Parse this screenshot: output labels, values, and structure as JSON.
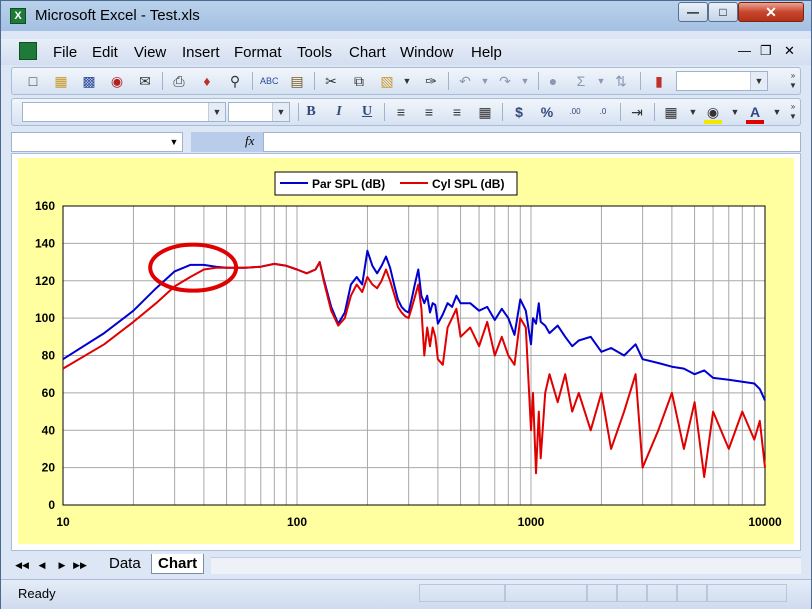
{
  "window": {
    "title": "Microsoft Excel - Test.xls",
    "app_icon": "excel-app-icon",
    "controls": {
      "minimize": "minimize-icon",
      "maximize": "maximize-icon",
      "close": "close-icon"
    }
  },
  "menubar": {
    "items": [
      {
        "label": "File"
      },
      {
        "label": "Edit"
      },
      {
        "label": "View"
      },
      {
        "label": "Insert"
      },
      {
        "label": "Format"
      },
      {
        "label": "Tools"
      },
      {
        "label": "Chart"
      },
      {
        "label": "Window"
      },
      {
        "label": "Help"
      }
    ]
  },
  "toolbar_standard": {
    "icons": [
      "new-icon",
      "open-icon",
      "save-icon",
      "permission-icon",
      "email-icon",
      "print-icon",
      "research-icon",
      "print-preview-icon",
      "spelling-icon",
      "research-book-icon",
      "cut-icon",
      "copy-icon",
      "paste-icon",
      "format-painter-icon",
      "undo-icon",
      "redo-icon",
      "hyperlink-icon",
      "autosum-icon",
      "sort-icon",
      "chart-wizard-icon"
    ],
    "zoom_value": ""
  },
  "toolbar_formatting": {
    "font_name": "",
    "font_size": "",
    "bold": "B",
    "italic": "I",
    "underline": "U",
    "icons": [
      "align-left-icon",
      "center-icon",
      "align-right-icon",
      "merge-center-icon",
      "currency-icon",
      "percent-icon",
      "increase-decimal-icon",
      "decrease-decimal-icon",
      "indent-icon",
      "borders-icon",
      "fill-color-icon",
      "font-color-icon"
    ],
    "fill_color": "#f5e600",
    "font_color": "#e00000"
  },
  "formula_bar": {
    "name_box": "",
    "fx_label": "fx",
    "content": ""
  },
  "chart_data": {
    "type": "line",
    "title": "",
    "xlabel": "",
    "ylabel": "",
    "xscale": "log",
    "xlim": [
      10,
      10000
    ],
    "ylim": [
      0,
      160
    ],
    "xticks": [
      "10",
      "100",
      "1000",
      "10000"
    ],
    "yticks": [
      "0",
      "20",
      "40",
      "60",
      "80",
      "100",
      "120",
      "140",
      "160"
    ],
    "grid": true,
    "legend": "top-center",
    "background": "#ffffa0",
    "series": [
      {
        "name": "Par SPL (dB)",
        "color": "#0000d0",
        "x": [
          10,
          15,
          20,
          25,
          30,
          35,
          40,
          45,
          50,
          60,
          70,
          80,
          90,
          100,
          110,
          120,
          125,
          130,
          140,
          150,
          160,
          170,
          180,
          190,
          200,
          210,
          220,
          230,
          240,
          250,
          260,
          270,
          280,
          290,
          300,
          310,
          320,
          330,
          340,
          350,
          360,
          370,
          380,
          390,
          400,
          420,
          440,
          460,
          480,
          500,
          550,
          600,
          650,
          700,
          750,
          800,
          850,
          900,
          950,
          1000,
          1020,
          1050,
          1080,
          1100,
          1150,
          1200,
          1300,
          1400,
          1500,
          1600,
          1800,
          2000,
          2200,
          2500,
          2800,
          3000,
          3500,
          4000,
          4500,
          5000,
          5500,
          6000,
          7000,
          8000,
          9000,
          9500,
          10000
        ],
        "y": [
          78,
          92,
          104,
          116,
          125,
          128.5,
          128.5,
          127.5,
          127,
          127,
          127.5,
          129,
          128,
          126,
          124,
          126,
          130,
          121,
          106,
          97,
          103,
          118,
          122,
          118,
          136,
          128,
          124,
          128,
          133,
          127,
          118,
          110,
          106,
          104,
          103,
          111,
          119,
          126,
          112,
          108,
          112,
          103,
          108,
          107,
          97,
          102,
          108,
          106,
          112,
          108,
          108,
          104,
          106,
          99,
          105,
          100,
          91,
          110,
          104,
          86,
          100,
          97,
          108,
          98,
          96,
          92,
          96,
          90,
          85,
          88,
          90,
          82,
          84,
          80,
          86,
          78,
          76,
          74,
          73,
          70,
          72,
          68,
          67,
          66,
          65,
          62,
          56
        ]
      },
      {
        "name": "Cyl SPL (dB)",
        "color": "#e00000",
        "x": [
          10,
          15,
          20,
          25,
          30,
          35,
          40,
          45,
          50,
          60,
          70,
          80,
          90,
          100,
          110,
          120,
          125,
          130,
          140,
          150,
          160,
          170,
          180,
          190,
          200,
          210,
          220,
          230,
          240,
          250,
          260,
          270,
          280,
          290,
          300,
          310,
          320,
          330,
          340,
          350,
          360,
          370,
          380,
          390,
          400,
          420,
          440,
          460,
          480,
          500,
          550,
          600,
          650,
          700,
          750,
          800,
          850,
          900,
          950,
          1000,
          1020,
          1050,
          1080,
          1100,
          1150,
          1200,
          1300,
          1400,
          1500,
          1600,
          1800,
          2000,
          2200,
          2500,
          2800,
          3000,
          3500,
          4000,
          4500,
          5000,
          5500,
          6000,
          7000,
          8000,
          9000,
          9500,
          10000
        ],
        "y": [
          73,
          86,
          98,
          108,
          117,
          122,
          126,
          127,
          127,
          127,
          127.5,
          129,
          128,
          126,
          124,
          126,
          130,
          120,
          104,
          96,
          100,
          112,
          118,
          114,
          122,
          118,
          116,
          120,
          126,
          120,
          113,
          106,
          103,
          101,
          100,
          106,
          112,
          118,
          105,
          80,
          95,
          85,
          95,
          90,
          78,
          75,
          95,
          100,
          105,
          90,
          95,
          85,
          98,
          80,
          90,
          80,
          75,
          100,
          95,
          40,
          60,
          17,
          50,
          25,
          60,
          70,
          55,
          70,
          50,
          60,
          40,
          60,
          30,
          50,
          70,
          20,
          40,
          60,
          30,
          55,
          15,
          50,
          30,
          50,
          35,
          45,
          20
        ]
      }
    ]
  },
  "sheet_tabs": {
    "tabs": [
      {
        "label": "Data"
      },
      {
        "label": "Chart"
      }
    ],
    "active": "Chart"
  },
  "statusbar": {
    "text": "Ready"
  }
}
